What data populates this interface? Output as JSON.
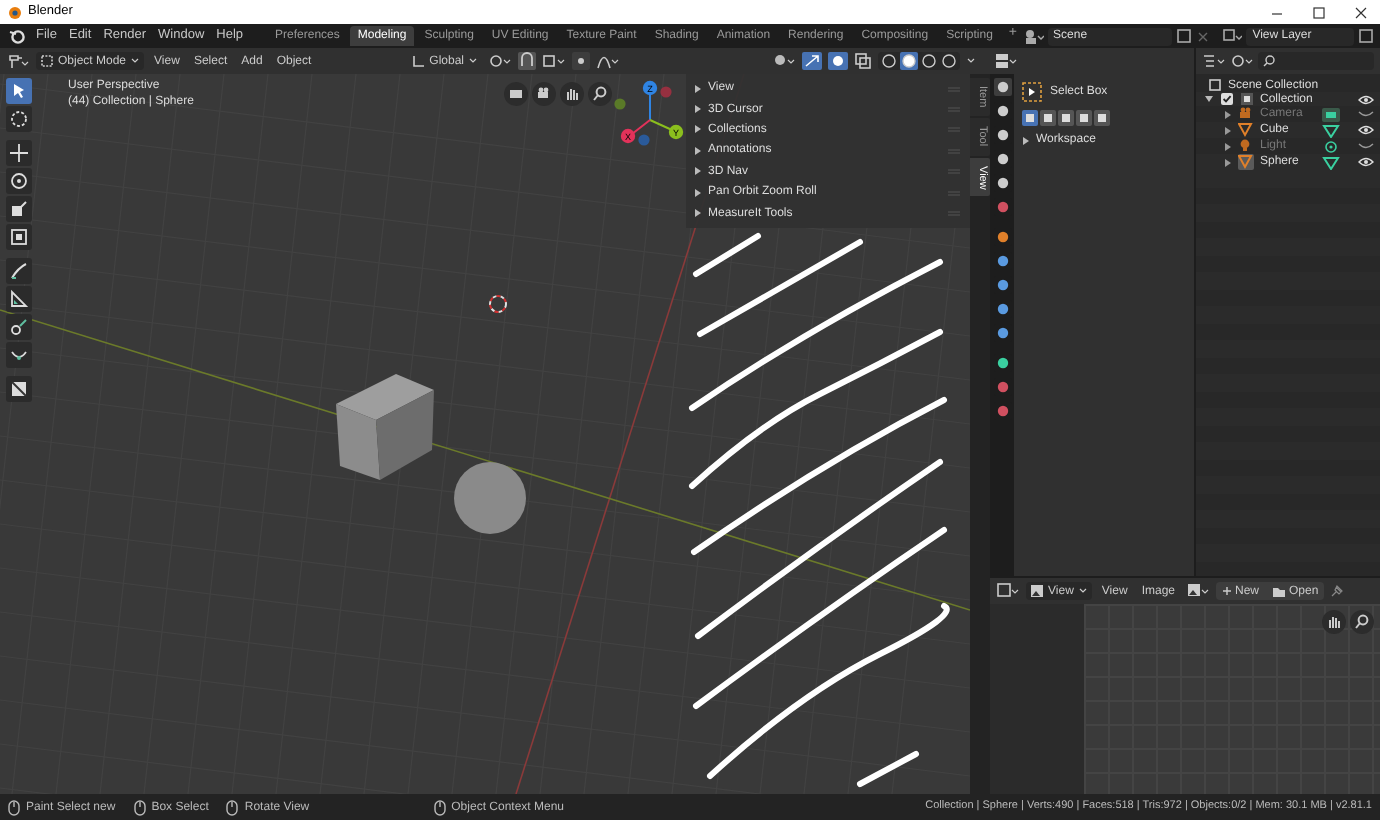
{
  "window": {
    "title": "Blender"
  },
  "menu": [
    "File",
    "Edit",
    "Render",
    "Window",
    "Help"
  ],
  "workspaces": [
    {
      "label": "Preferences",
      "selected": false
    },
    {
      "label": "Modeling",
      "selected": true
    },
    {
      "label": "Sculpting",
      "selected": false
    },
    {
      "label": "UV Editing",
      "selected": false
    },
    {
      "label": "Texture Paint",
      "selected": false
    },
    {
      "label": "Shading",
      "selected": false
    },
    {
      "label": "Animation",
      "selected": false
    },
    {
      "label": "Rendering",
      "selected": false
    },
    {
      "label": "Compositing",
      "selected": false
    },
    {
      "label": "Scripting",
      "selected": false
    }
  ],
  "add_workspace": "+",
  "scene": "Scene",
  "view_layer": "View Layer",
  "viewport_header": {
    "mode": "Object Mode",
    "menus": [
      "View",
      "Select",
      "Add",
      "Object"
    ],
    "orientation": "Global",
    "shading": [
      {
        "selected": false
      },
      {
        "selected": true
      },
      {
        "selected": false
      },
      {
        "selected": false
      }
    ]
  },
  "viewport": {
    "info": [
      "User Perspective",
      "(44) Collection | Sphere"
    ],
    "axes": [
      "X",
      "Y",
      "Z"
    ],
    "tools": [
      {
        "kind": "select",
        "selected": true
      },
      {
        "kind": "cursor",
        "selected": false
      },
      {
        "kind": "move",
        "selected": false
      },
      {
        "kind": "rotate",
        "selected": false
      },
      {
        "kind": "scale",
        "selected": false
      },
      {
        "kind": "transform",
        "selected": false
      },
      {
        "kind": "annotate",
        "selected": false
      },
      {
        "kind": "measure",
        "selected": false
      },
      {
        "kind": "shear",
        "selected": false
      },
      {
        "kind": "spin",
        "selected": false
      },
      {
        "kind": "addcube",
        "selected": false
      }
    ]
  },
  "sidebar": {
    "tabs": [
      {
        "label": "Item",
        "selected": false
      },
      {
        "label": "Tool",
        "selected": false
      },
      {
        "label": "View",
        "selected": true
      }
    ],
    "panels": [
      "View",
      "3D Cursor",
      "Collections",
      "Annotations",
      "3D Nav",
      "Pan Orbit Zoom Roll",
      "MeasureIt Tools"
    ]
  },
  "properties": {
    "tool": "Select Box",
    "modes": [
      {
        "selected": true
      },
      {
        "selected": false
      },
      {
        "selected": false
      },
      {
        "selected": false
      },
      {
        "selected": false
      }
    ],
    "panels": [
      "Workspace"
    ]
  },
  "outliner": {
    "root": "Scene Collection",
    "collection": {
      "label": "Collection",
      "checked": true,
      "children": [
        {
          "label": "Camera",
          "kind": "camera",
          "visible": false,
          "selected": false
        },
        {
          "label": "Cube",
          "kind": "mesh",
          "visible": true,
          "selected": false
        },
        {
          "label": "Light",
          "kind": "light",
          "visible": false,
          "selected": false
        },
        {
          "label": "Sphere",
          "kind": "mesh",
          "visible": true,
          "selected": true
        }
      ]
    }
  },
  "image_editor": {
    "view_mode": "View",
    "menus": [
      "View",
      "Image"
    ],
    "buttons": [
      {
        "label": "New",
        "kind": "new"
      },
      {
        "label": "Open",
        "kind": "open"
      }
    ]
  },
  "status_bar": {
    "hints": [
      "Paint Select new",
      "Box Select",
      "Rotate View",
      "Object Context Menu"
    ],
    "stats": "Collection | Sphere | Verts:490 | Faces:518 | Tris:972 | Objects:0/2 | Mem: 30.1 MB | v2.81.1"
  }
}
